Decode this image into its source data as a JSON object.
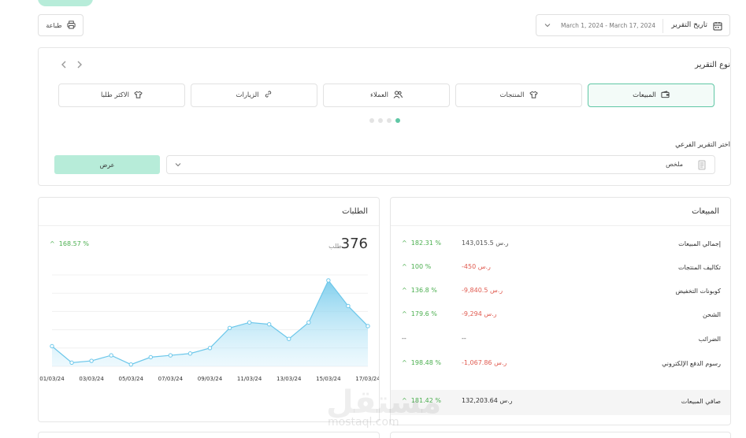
{
  "header": {
    "print_label": "طباعة",
    "date_label": "تاريخ التقرير",
    "date_range": "March 1, 2024 - March 17, 2024"
  },
  "report_type": {
    "title": "نوع التقرير",
    "tabs": [
      {
        "label": "المبيعات",
        "icon": "wallet-icon",
        "active": true
      },
      {
        "label": "المنتجات",
        "icon": "shirt-icon",
        "active": false
      },
      {
        "label": "العملاء",
        "icon": "users-icon",
        "active": false
      },
      {
        "label": "الزيارات",
        "icon": "link-icon",
        "active": false
      },
      {
        "label": "الاكثر طلبا",
        "icon": "shirt-icon",
        "active": false
      }
    ],
    "subreport_label": "اختر التقرير الفرعي",
    "subreport_value": "ملخص",
    "show_label": "عرض"
  },
  "sales": {
    "title": "المبيعات",
    "rows": [
      {
        "label": "إجمالي المبيعات",
        "value": "143,015.5 ر.س",
        "pct": "182.31 %",
        "negative": false
      },
      {
        "label": "تكاليف المنتجات",
        "value": "-450 ر.س",
        "pct": "100 %",
        "negative": true
      },
      {
        "label": "كوبونات التخفيض",
        "value": "-9,840.5 ر.س",
        "pct": "136.8 %",
        "negative": true
      },
      {
        "label": "الشحن",
        "value": "-9,294 ر.س",
        "pct": "179.6 %",
        "negative": true
      },
      {
        "label": "الضرائب",
        "value": "--",
        "pct": "--",
        "negative": false
      },
      {
        "label": "رسوم الدفع الإلكتروني",
        "value": "-1,067.86 ر.س",
        "pct": "198.48 %",
        "negative": true
      }
    ],
    "total": {
      "label": "صافي المبيعات",
      "value": "132,203.64 ر.س",
      "pct": "181.42 %"
    }
  },
  "orders": {
    "title": "الطلبات",
    "count": "376",
    "unit": "طلب",
    "pct": "168.57 %"
  },
  "chart_data": {
    "type": "area",
    "x": [
      "01/03/24",
      "02/03/24",
      "03/03/24",
      "04/03/24",
      "05/03/24",
      "06/03/24",
      "07/03/24",
      "08/03/24",
      "09/03/24",
      "10/03/24",
      "11/03/24",
      "12/03/24",
      "13/03/24",
      "14/03/24",
      "15/03/24",
      "16/03/24",
      "17/03/24"
    ],
    "xticks": [
      "01/03/24",
      "03/03/24",
      "05/03/24",
      "07/03/24",
      "09/03/24",
      "11/03/24",
      "13/03/24",
      "15/03/24",
      "17/03/24"
    ],
    "values": [
      11,
      2,
      3,
      6,
      1,
      5,
      6,
      7,
      10,
      21,
      24,
      23,
      15,
      24,
      47,
      33,
      22
    ],
    "ylim": [
      0,
      50
    ],
    "colors": {
      "line": "#6cc7ea",
      "fill": "#cdeefb",
      "point": "#ffffff"
    }
  },
  "watermark": {
    "text": "مستقل",
    "sub": "mostaql.com"
  },
  "colors": {
    "accent": "#5fc7a5",
    "accent_light": "#b7ecd9",
    "positive": "#4caf50",
    "negative": "#e05a4f"
  }
}
